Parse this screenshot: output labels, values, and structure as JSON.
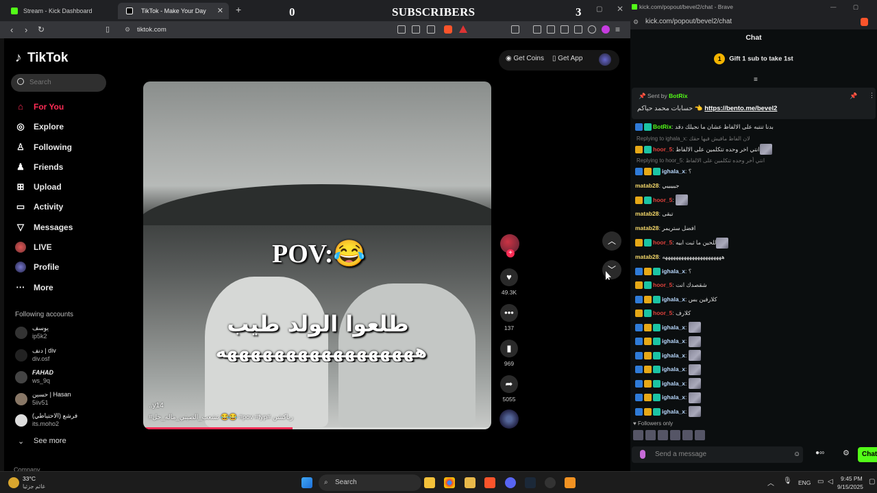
{
  "browser_left": {
    "tabs": [
      {
        "label": "Stream - Kick Dashboard"
      },
      {
        "label": "TikTok - Make Your Day"
      }
    ],
    "url": "tiktok.com"
  },
  "overlay": {
    "count_left": "0",
    "subscribers_label": "SUBSCRIBERS",
    "count_right": "3"
  },
  "tiktok": {
    "logo": "TikTok",
    "search_placeholder": "Search",
    "get_coins": "Get Coins",
    "get_app": "Get App",
    "nav": [
      {
        "label": "For You",
        "icon": "home-icon",
        "active": true
      },
      {
        "label": "Explore",
        "icon": "compass-icon"
      },
      {
        "label": "Following",
        "icon": "following-icon"
      },
      {
        "label": "Friends",
        "icon": "friends-icon"
      },
      {
        "label": "Upload",
        "icon": "upload-icon"
      },
      {
        "label": "Activity",
        "icon": "activity-icon"
      },
      {
        "label": "Messages",
        "icon": "messages-icon"
      },
      {
        "label": "LIVE",
        "icon": "live-icon"
      },
      {
        "label": "Profile",
        "icon": "profile-icon"
      },
      {
        "label": "More",
        "icon": "more-icon"
      }
    ],
    "following_header": "Following accounts",
    "following_accounts": [
      {
        "name": "يوسف",
        "handle": "ip5k2"
      },
      {
        "name": "دنف | div",
        "handle": "div.osf"
      },
      {
        "name": "FAHAD",
        "handle": "ws_9q"
      },
      {
        "name": "حسين | Hasan",
        "handle": "5iiv51"
      },
      {
        "name": "فرشع (الاحتياطي)",
        "handle": "its.moho2"
      }
    ],
    "see_more": "See more",
    "company": "Company",
    "video": {
      "pov_text": "POV:😂",
      "arabic_line1": "طلعوا الولد طيب",
      "arabic_line2": "هههههههههههههههههه",
      "author": "..y14",
      "caption": "#تشعب_الصيني_ماله_حل 😂😂 #pov #fyp# رياكشن",
      "progress": 0.43
    },
    "actions": {
      "likes": "49.3K",
      "comments": "137",
      "saves": "969",
      "shares": "5055"
    }
  },
  "kick": {
    "title": "kick.com/popout/bevel2/chat - Brave",
    "url": "kick.com/popout/bevel2/chat",
    "chat_header": "Chat",
    "gift_rank": "1",
    "gift_text": "Gift 1 sub to take 1st",
    "pinned": {
      "sent_by_label": "Sent by",
      "sender": "BotRix",
      "message": "حسابات محمد حياكم 👈",
      "link": "https://bento.me/bevel2"
    },
    "messages": [
      {
        "user": "BotRix",
        "text": "بدنا تنتبه على الالفاظ عشان ما نجيلك دقد",
        "color": "green",
        "badges": 1
      },
      {
        "reply": "Replying to ighala_x: لان الفاظ مافيش فيها حقك"
      },
      {
        "user": "hoor_5",
        "text": "انتي اخر وحده تتكلمين على الالفاظ",
        "color": "red",
        "badges": 2,
        "emote": true
      },
      {
        "reply": "Replying to hoor_5: انتي أخر وحده تتكلمين على الالفاظ"
      },
      {
        "user": "ighala_x",
        "text": "؟",
        "color": "lt",
        "badges": 3
      },
      {
        "user": "matab28",
        "text": "جيييييي",
        "color": "yellow",
        "badges": 0
      },
      {
        "user": "hoor_5",
        "text": "",
        "color": "red",
        "badges": 2,
        "emote": true
      },
      {
        "user": "matab28",
        "text": "تبقى",
        "color": "yellow",
        "badges": 0
      },
      {
        "user": "matab28",
        "text": "افضل ستريمر",
        "color": "yellow",
        "badges": 0
      },
      {
        "user": "hoor_5",
        "text": "للحين ما ثبت ابيه",
        "color": "red",
        "badges": 2,
        "emote": true
      },
      {
        "user": "matab28",
        "text": "ههههههههههههههههههههههه",
        "color": "yellow",
        "badges": 0
      },
      {
        "user": "ighala_x",
        "text": "؟",
        "color": "lt",
        "badges": 3
      },
      {
        "user": "hoor_5",
        "text": "شقصدك انت",
        "color": "red",
        "badges": 2
      },
      {
        "user": "ighala_x",
        "text": "كلارفين بس",
        "color": "lt",
        "badges": 3
      },
      {
        "user": "hoor_5",
        "text": "كلارف",
        "color": "red",
        "badges": 2
      },
      {
        "user": "ighala_x",
        "text": "",
        "color": "lt",
        "badges": 3,
        "emote": true
      },
      {
        "user": "ighala_x",
        "text": "",
        "color": "lt",
        "badges": 3,
        "emote": true
      },
      {
        "user": "ighala_x",
        "text": "",
        "color": "lt",
        "badges": 3,
        "emote": true
      },
      {
        "user": "ighala_x",
        "text": "",
        "color": "lt",
        "badges": 3,
        "emote": true
      },
      {
        "user": "ighala_x",
        "text": "",
        "color": "lt",
        "badges": 3,
        "emote": true
      },
      {
        "user": "ighala_x",
        "text": "",
        "color": "lt",
        "badges": 3,
        "emote": true
      },
      {
        "user": "ighala_x",
        "text": "",
        "color": "lt",
        "badges": 3,
        "emote": true
      }
    ],
    "followers_only": "Followers only",
    "input_placeholder": "Send a message",
    "chat_button": "Chat"
  },
  "taskbar": {
    "weather_temp": "33°C",
    "weather_loc": "غائم جزئيا",
    "search_label": "Search",
    "lang": "ENG",
    "time": "9:45 PM",
    "date": "9/15/2025"
  },
  "colors": {
    "tiktok_accent": "#fe2c55",
    "kick_green": "#53fc18"
  }
}
